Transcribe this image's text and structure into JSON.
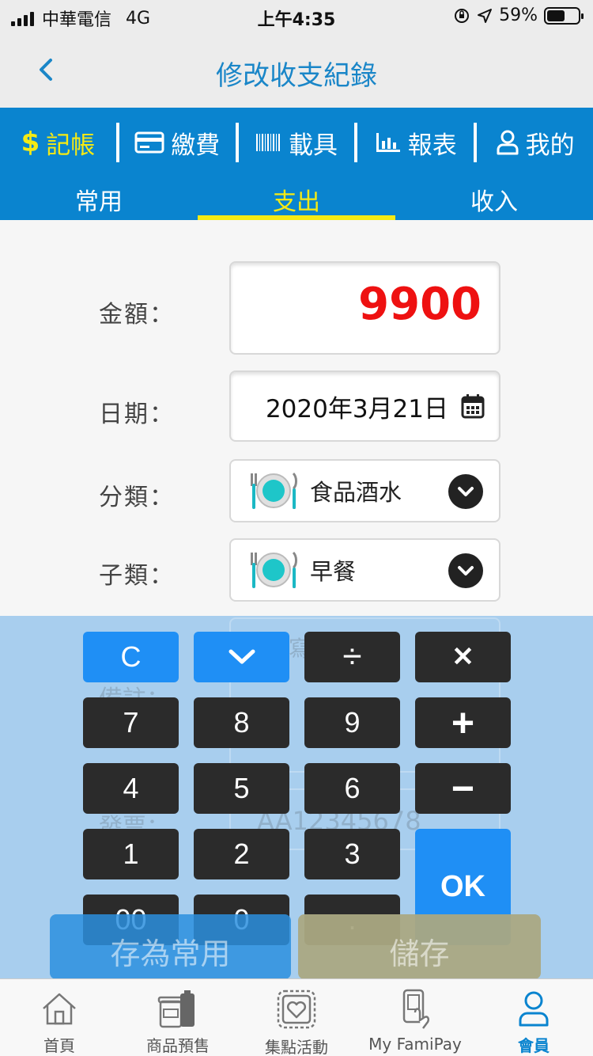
{
  "status_bar": {
    "carrier": "中華電信",
    "network": "4G",
    "time": "上午4:35",
    "battery_percent": "59%",
    "battery_level": 0.59
  },
  "nav": {
    "title": "修改收支紀錄",
    "back_icon": "chevron-left-icon"
  },
  "menu": {
    "items": [
      {
        "label": "記帳",
        "icon": "dollar-icon",
        "active": true
      },
      {
        "label": "繳費",
        "icon": "credit-card-icon",
        "active": false
      },
      {
        "label": "載具",
        "icon": "barcode-icon",
        "active": false
      },
      {
        "label": "報表",
        "icon": "bar-chart-icon",
        "active": false
      },
      {
        "label": "我的",
        "icon": "user-icon",
        "active": false
      }
    ],
    "dollar_symbol": "$"
  },
  "sub_tabs": [
    {
      "label": "常用",
      "active": false
    },
    {
      "label": "支出",
      "active": true
    },
    {
      "label": "收入",
      "active": false
    }
  ],
  "form": {
    "amount_label": "金額：",
    "amount_value": "9900",
    "date_label": "日期：",
    "date_value": "2020年3月21日",
    "category_label": "分類：",
    "category_value": "食品酒水",
    "subcategory_label": "子類：",
    "subcategory_value": "早餐",
    "note_label": "備註：",
    "note_placeholder": "寫",
    "invoice_label": "發票：",
    "invoice_placeholder": "AA12345678"
  },
  "keypad": {
    "clear": "C",
    "collapse_icon": "chevron-down-icon",
    "divide": "÷",
    "multiply": "✕",
    "plus": "+",
    "minus": "−",
    "k7": "7",
    "k8": "8",
    "k9": "9",
    "k4": "4",
    "k5": "5",
    "k6": "6",
    "k1": "1",
    "k2": "2",
    "k3": "3",
    "k00": "00",
    "k0": "0",
    "dot": ".",
    "ok": "OK"
  },
  "actions": {
    "save_favorite": "存為常用",
    "save": "儲存"
  },
  "tab_bar": [
    {
      "label": "首頁",
      "icon": "home-icon",
      "active": false
    },
    {
      "label": "商品預售",
      "icon": "coffee-cups-icon",
      "active": false
    },
    {
      "label": "集點活動",
      "icon": "heart-card-icon",
      "active": false
    },
    {
      "label": "My FamiPay",
      "icon": "phone-pay-icon",
      "active": false
    },
    {
      "label": "會員",
      "icon": "member-icon",
      "active": true
    }
  ],
  "colors": {
    "brand_blue": "#0a84cf",
    "active_yellow": "#f5ea14",
    "amount_red": "#ee1111",
    "key_dark": "#2b2b2b",
    "key_blue": "#1f8ff5"
  }
}
